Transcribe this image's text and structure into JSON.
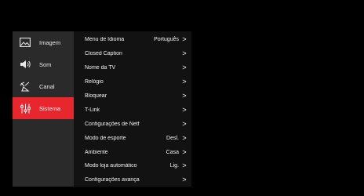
{
  "sidebar": {
    "items": [
      {
        "label": "Imagem",
        "icon": "picture-icon",
        "active": false
      },
      {
        "label": "Som",
        "icon": "speaker-icon",
        "active": false
      },
      {
        "label": "Canal",
        "icon": "antenna-icon",
        "active": false
      },
      {
        "label": "Sistema",
        "icon": "sliders-icon",
        "active": true
      }
    ]
  },
  "submenu": {
    "items": [
      {
        "label": "Menu de Idioma",
        "value": "Português",
        "chevron": ">"
      },
      {
        "label": "Closed Caption",
        "value": "",
        "chevron": ">"
      },
      {
        "label": "Nome da TV",
        "value": "",
        "chevron": ">"
      },
      {
        "label": "Relógio",
        "value": "",
        "chevron": ">"
      },
      {
        "label": "Bloquear",
        "value": "",
        "chevron": ">"
      },
      {
        "label": "T-Link",
        "value": "",
        "chevron": ">"
      },
      {
        "label": "Configurações de Netf",
        "value": "",
        "chevron": ">"
      },
      {
        "label": "Modo de esporte",
        "value": "Desl.",
        "chevron": ">"
      },
      {
        "label": "Ambiente",
        "value": "Casa",
        "chevron": ">"
      },
      {
        "label": "Modo loja automático",
        "value": "Lig.",
        "chevron": ">"
      },
      {
        "label": "Configurações avança",
        "value": "",
        "chevron": ">"
      }
    ]
  },
  "colors": {
    "accent": "#e8262e",
    "sidebar_bg": "#2a2a2a",
    "submenu_bg": "#121212",
    "background": "#000000"
  }
}
